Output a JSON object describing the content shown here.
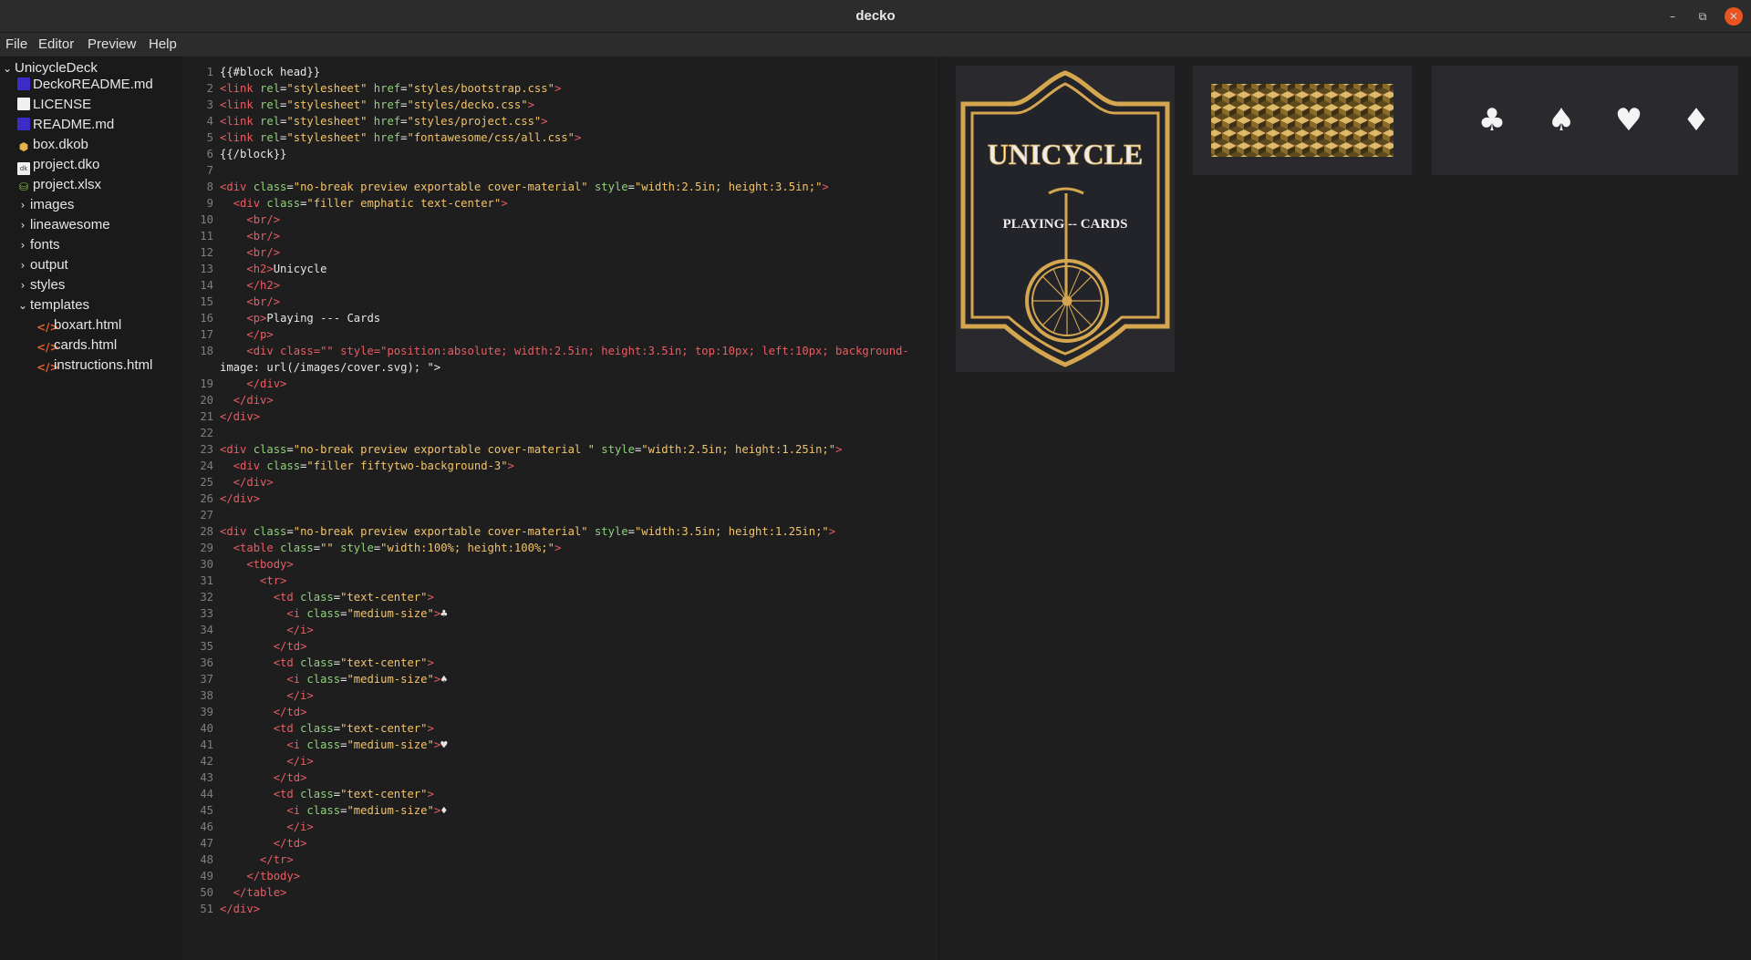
{
  "window": {
    "title": "decko",
    "controls": {
      "minimize": "–",
      "maximize": "⧉",
      "close": "✕"
    }
  },
  "menubar": {
    "items": [
      "File",
      "Editor",
      "Preview",
      "Help"
    ]
  },
  "sidebar": {
    "root": "UnicycleDeck",
    "items": [
      {
        "label": "DeckoREADME.md",
        "icon": "markdown-file-icon"
      },
      {
        "label": "LICENSE",
        "icon": "text-file-icon"
      },
      {
        "label": "README.md",
        "icon": "markdown-file-icon"
      },
      {
        "label": "box.dkob",
        "icon": "box-icon"
      },
      {
        "label": "project.dko",
        "icon": "project-file-icon"
      },
      {
        "label": "project.xlsx",
        "icon": "database-icon"
      },
      {
        "label": "images",
        "icon": "folder-collapsed"
      },
      {
        "label": "lineawesome",
        "icon": "folder-collapsed"
      },
      {
        "label": "fonts",
        "icon": "folder-collapsed"
      },
      {
        "label": "output",
        "icon": "folder-collapsed"
      },
      {
        "label": "styles",
        "icon": "folder-collapsed"
      },
      {
        "label": "templates",
        "icon": "folder-expanded"
      },
      {
        "label": "boxart.html",
        "icon": "html-file-icon"
      },
      {
        "label": "cards.html",
        "icon": "html-file-icon"
      },
      {
        "label": "instructions.html",
        "icon": "html-file-icon"
      }
    ]
  },
  "editor": {
    "lines": [
      "{{#block head}}",
      "<link rel=\"stylesheet\" href=\"styles/bootstrap.css\">",
      "<link rel=\"stylesheet\" href=\"styles/decko.css\">",
      "<link rel=\"stylesheet\" href=\"styles/project.css\">",
      "<link rel=\"stylesheet\" href=\"fontawesome/css/all.css\">",
      "{{/block}}",
      "",
      "<div class=\"no-break preview exportable cover-material\" style=\"width:2.5in; height:3.5in;\">",
      "  <div class=\"filler emphatic text-center\">",
      "    <br/>",
      "    <br/>",
      "    <br/>",
      "    <h2>Unicycle",
      "    </h2>",
      "    <br/>",
      "    <p>Playing --- Cards",
      "    </p>",
      "    <div class=\"\" style=\"position:absolute; width:2.5in; height:3.5in; top:10px; left:10px; background-image: url(/images/cover.svg); \">",
      "    </div>",
      "  </div>",
      "</div>",
      "",
      "<div class=\"no-break preview exportable cover-material \" style=\"width:2.5in; height:1.25in;\">",
      "  <div class=\"filler fiftytwo-background-3\">",
      "  </div>",
      "</div>",
      "",
      "<div class=\"no-break preview exportable cover-material\" style=\"width:3.5in; height:1.25in;\">",
      "  <table class=\"\" style=\"width:100%; height:100%;\">",
      "    <tbody>",
      "      <tr>",
      "        <td class=\"text-center\">",
      "          <i class=\"medium-size\">♣",
      "          </i>",
      "        </td>",
      "        <td class=\"text-center\">",
      "          <i class=\"medium-size\">♠",
      "          </i>",
      "        </td>",
      "        <td class=\"text-center\">",
      "          <i class=\"medium-size\">♥",
      "          </i>",
      "        </td>",
      "        <td class=\"text-center\">",
      "          <i class=\"medium-size\">♦",
      "          </i>",
      "        </td>",
      "      </tr>",
      "    </tbody>",
      "  </table>",
      "</div>"
    ],
    "wrapped_continuation": "image: url(/images/cover.svg); \">"
  },
  "preview": {
    "cover": {
      "title": "UNICYCLE",
      "subtitle": "PLAYING -- CARDS"
    },
    "suits": [
      "♣",
      "♠",
      "♥",
      "♦"
    ],
    "colors": {
      "gold": "#d4a64f",
      "card": "#2a2a2e",
      "pattern_dark": "#5e4a1e"
    }
  }
}
